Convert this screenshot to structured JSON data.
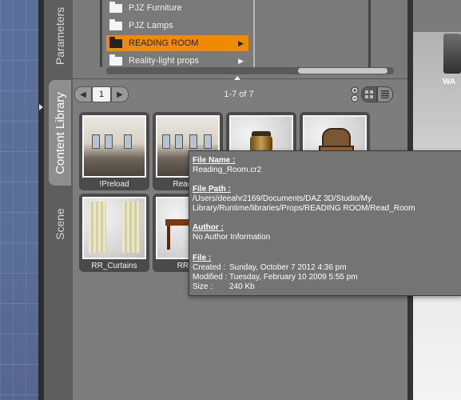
{
  "tabs": {
    "parameters": "Parameters",
    "content_library": "Content Library",
    "scene": "Scene"
  },
  "tree": {
    "folders": [
      {
        "label": "PJZ Furniture",
        "selected": false,
        "has_children": false
      },
      {
        "label": "PJZ Lamps",
        "selected": false,
        "has_children": false
      },
      {
        "label": "READING ROOM",
        "selected": true,
        "has_children": true
      },
      {
        "label": "Reality-light props",
        "selected": false,
        "has_children": true
      }
    ]
  },
  "toolbar": {
    "prev_icon": "chevron-left-icon",
    "next_icon": "chevron-right-icon",
    "page": "1",
    "count_label": "1-7 of 7",
    "zoom_icon": "zoom-plus-minus-icon",
    "grid_icon": "grid-view-icon",
    "list_icon": "list-view-icon"
  },
  "thumbnails": [
    {
      "caption": "!Preload",
      "kind": "room"
    },
    {
      "caption": "Reading",
      "kind": "room"
    },
    {
      "caption": "",
      "kind": "lamp"
    },
    {
      "caption": "",
      "kind": "chair"
    },
    {
      "caption": "RR_Curtains",
      "kind": "curtains"
    },
    {
      "caption": "RR_S",
      "kind": "table"
    }
  ],
  "tooltip": {
    "file_name_label": "File Name :",
    "file_name": "Reading_Room.cr2",
    "file_path_label": "File Path :",
    "file_path_line1": "/Users/deeahr2169/Documents/DAZ 3D/Studio/My",
    "file_path_line2": "Library/Runtime/libraries/Props/READING ROOM/Read_Room",
    "author_label": "Author :",
    "author": "No Author Information",
    "file_label": "File :",
    "created_key": "Created :",
    "created_value": "Sunday, October 7 2012 4:36 pm",
    "modified_key": "Modified :",
    "modified_value": "Tuesday, February 10 2009 5:55 pm",
    "size_key": "Size :",
    "size_value": "240 Kb"
  },
  "desktop": {
    "drive_label": "WA"
  },
  "colors": {
    "selected_folder": "#f08a00",
    "viewport_blue": "#5a6f9a",
    "tooltip_bg": "#747474"
  }
}
